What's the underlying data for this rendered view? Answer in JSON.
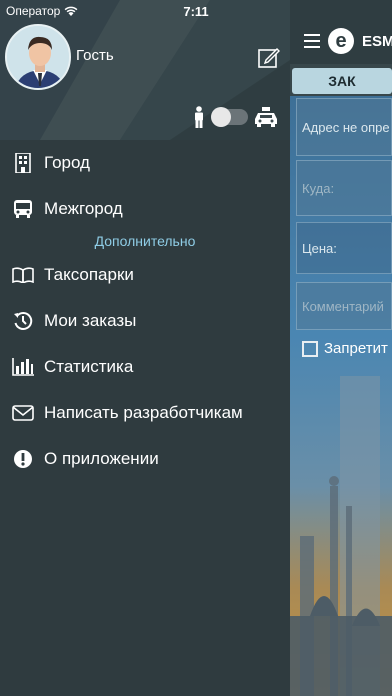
{
  "status_bar": {
    "carrier": "Оператор",
    "time": "7:11"
  },
  "profile": {
    "name": "Гость"
  },
  "menu": {
    "items": [
      {
        "label": "Город",
        "icon": "building-icon"
      },
      {
        "label": "Межгород",
        "icon": "bus-icon"
      }
    ],
    "section_label": "Дополнительно",
    "extra_items": [
      {
        "label": "Таксопарки",
        "icon": "book-icon"
      },
      {
        "label": "Мои заказы",
        "icon": "history-icon"
      },
      {
        "label": "Статистика",
        "icon": "bar-chart-icon"
      },
      {
        "label": "Написать разработчикам",
        "icon": "envelope-icon"
      },
      {
        "label": "О приложении",
        "icon": "info-icon"
      }
    ]
  },
  "main": {
    "app_title": "ESM",
    "logo_letter": "e",
    "tab_label": "ЗАК",
    "fields": {
      "address": "Адрес не опре",
      "destination_placeholder": "Куда:",
      "price_label": "Цена:",
      "comment_placeholder": "Комментарий"
    },
    "checkbox_label": "Запретит"
  },
  "colors": {
    "drawer_bg": "#2f3b3f",
    "accent_section": "#8fcde6",
    "tab_bg": "#b9d6e0"
  }
}
